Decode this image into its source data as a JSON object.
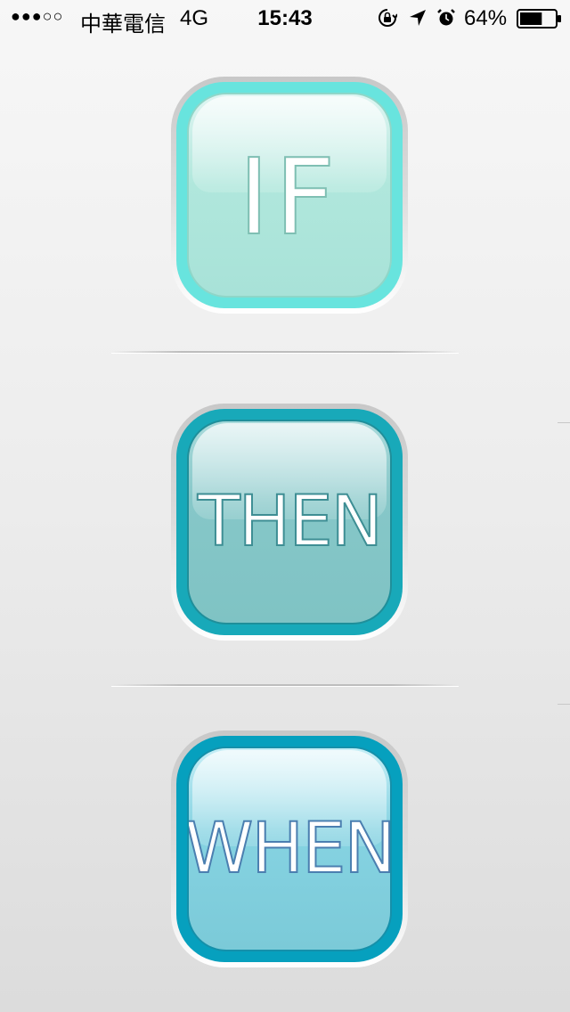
{
  "status_bar": {
    "signal": "●●●○○",
    "carrier": "中華電信",
    "network": "4G",
    "time": "15:43",
    "battery_percent": "64%",
    "battery_level": 0.64,
    "icons": [
      "rotation-lock-icon",
      "location-arrow-icon",
      "alarm-clock-icon",
      "battery-icon"
    ]
  },
  "buttons": {
    "if_label": "IF",
    "then_label": "THEN",
    "when_label": "WHEN"
  },
  "colors": {
    "if_ring": "#68e4de",
    "then_ring": "#18a9b9",
    "when_ring": "#06a0be"
  }
}
